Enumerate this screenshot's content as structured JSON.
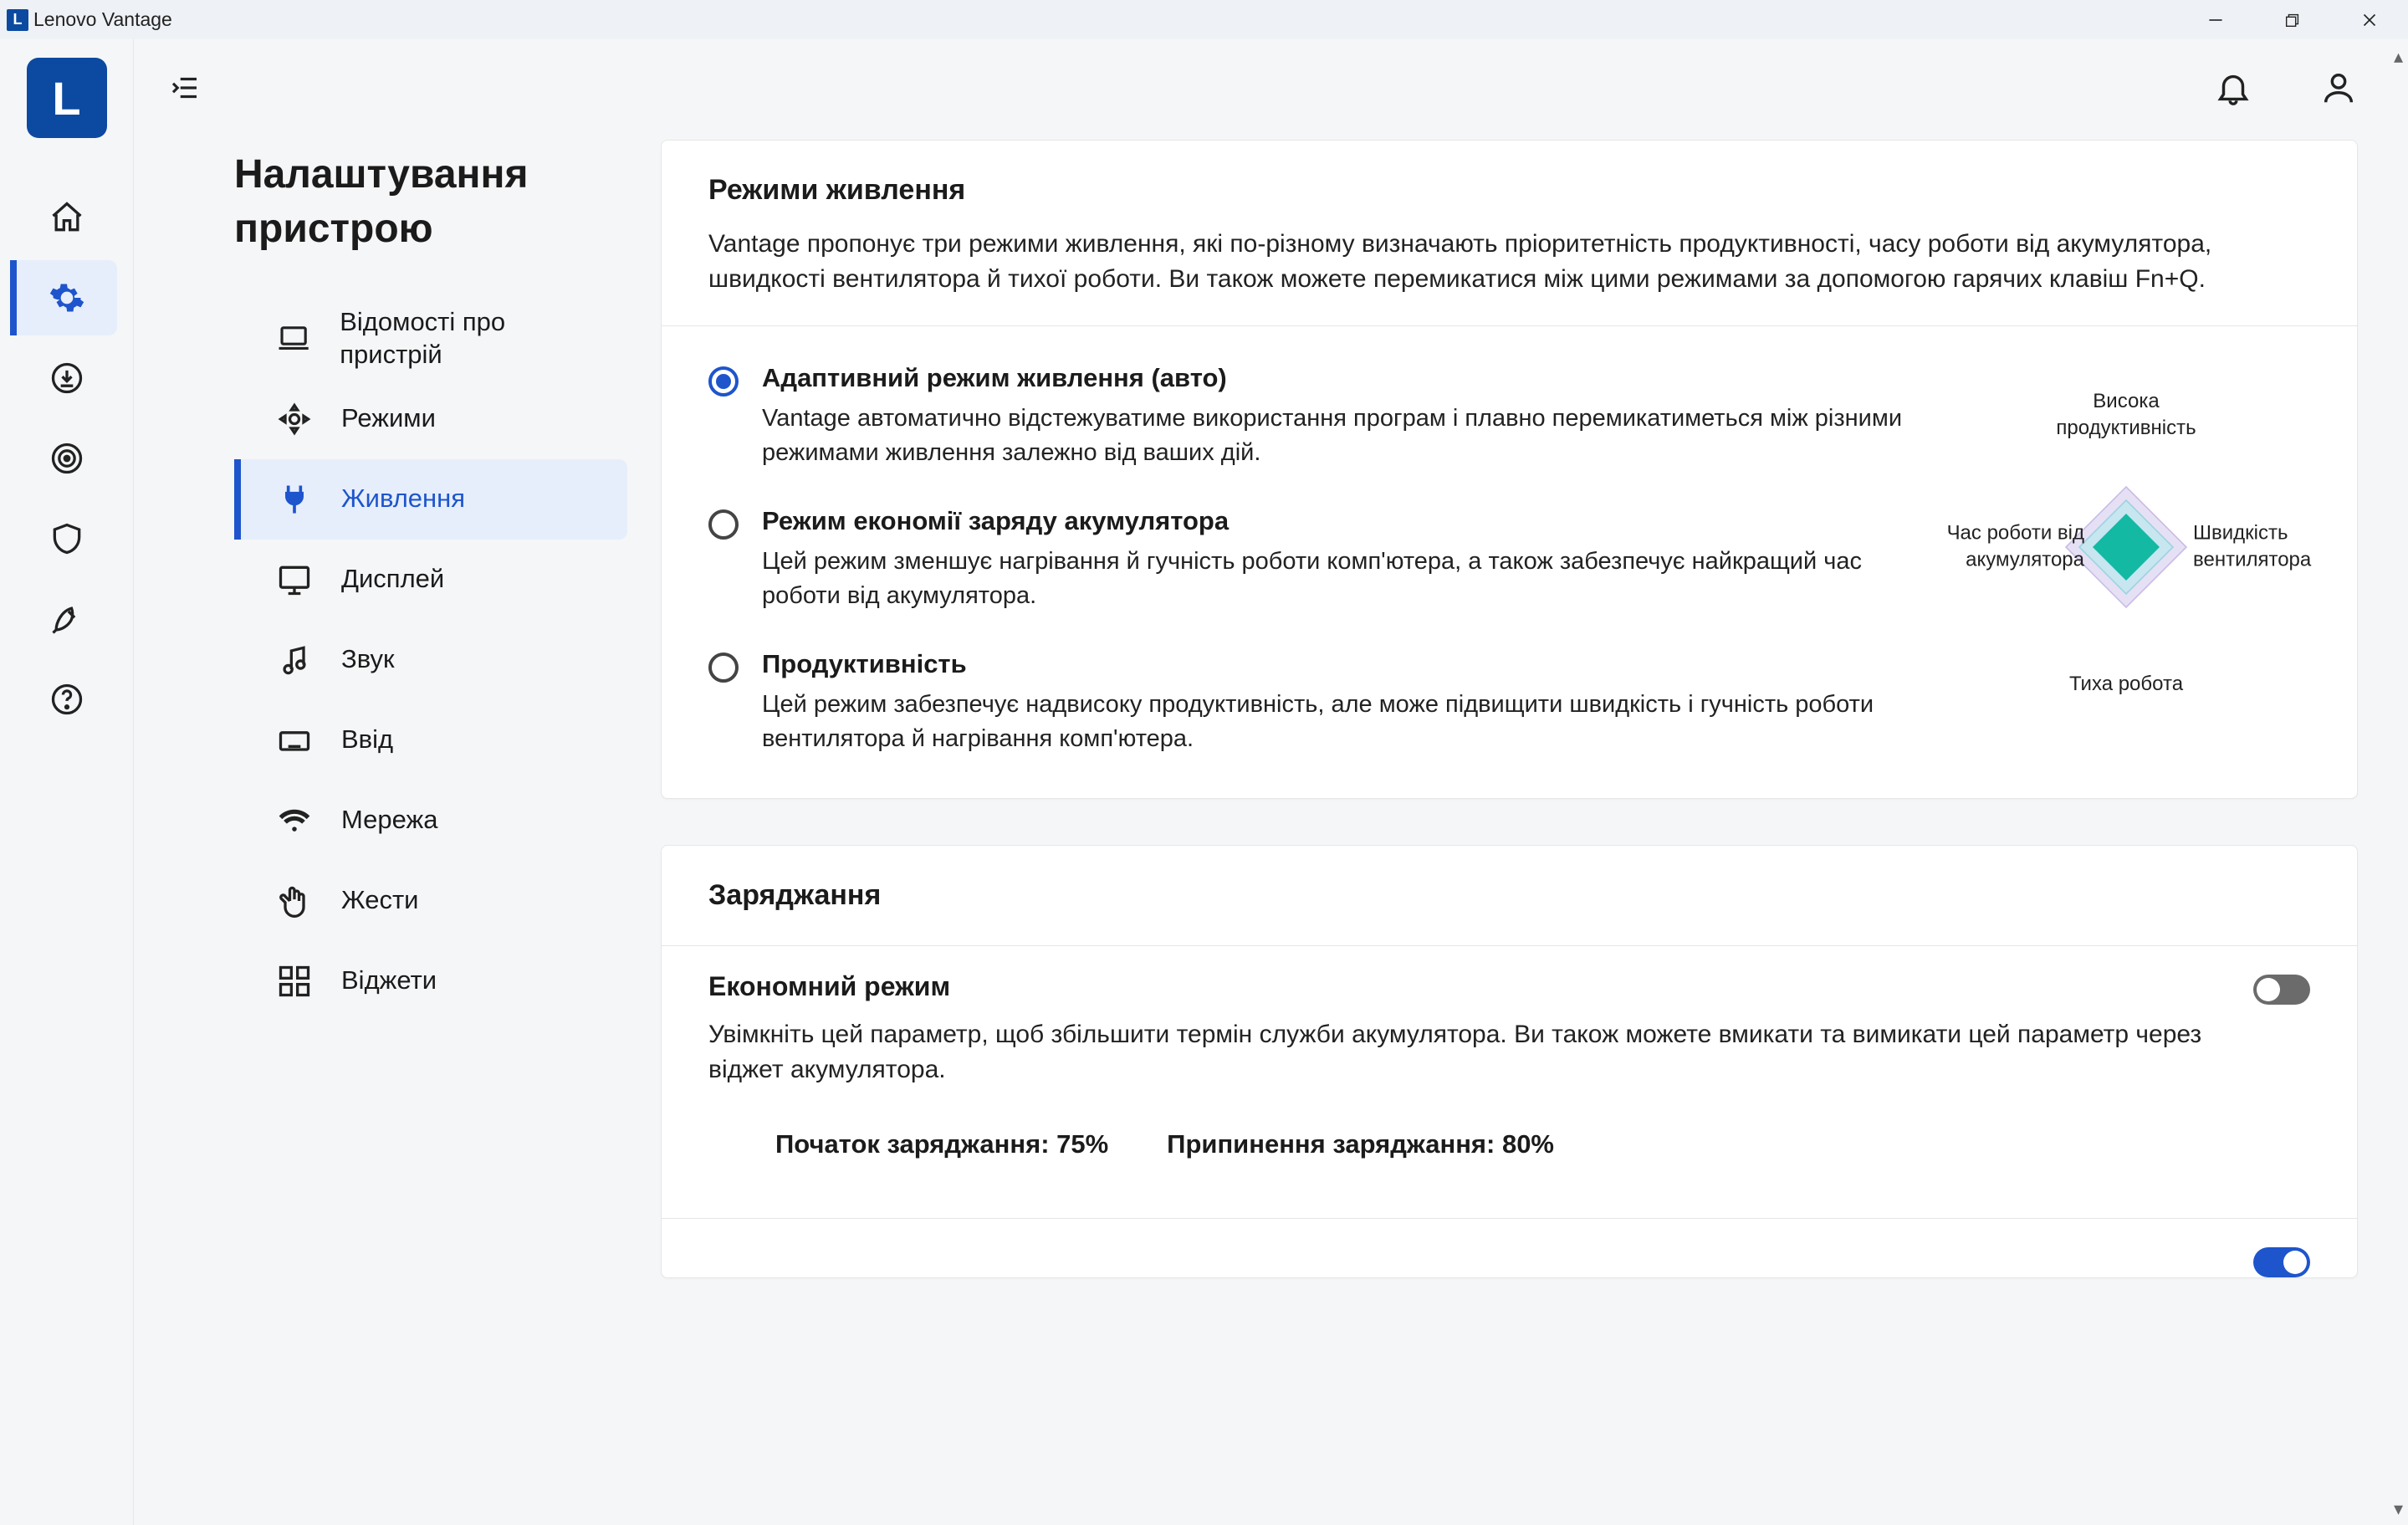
{
  "window": {
    "title": "Lenovo Vantage"
  },
  "sidebar_rail": {
    "items": [
      "home",
      "settings",
      "download",
      "target",
      "shield",
      "rocket",
      "help"
    ],
    "active": 1
  },
  "settings": {
    "title": "Налаштування пристрою",
    "items": [
      {
        "label": "Відомості про пристрій"
      },
      {
        "label": "Режими"
      },
      {
        "label": "Живлення"
      },
      {
        "label": "Дисплей"
      },
      {
        "label": "Звук"
      },
      {
        "label": "Ввід"
      },
      {
        "label": "Мережа"
      },
      {
        "label": "Жести"
      },
      {
        "label": "Віджети"
      }
    ],
    "active": 2
  },
  "power_modes": {
    "title": "Режими живлення",
    "description": "Vantage пропонує три режими живлення, які по-різному визначають пріоритетність продуктивності, часу роботи від акумулятора, швидкості вентилятора й тихої роботи. Ви також можете перемикатися між цими режимами за допомогою гарячих клавіш Fn+Q.",
    "options": [
      {
        "label": "Адаптивний режим живлення (авто)",
        "desc": "Vantage автоматично відстежуватиме використання програм і плавно перемикатиметься між різними режимами живлення залежно від ваших дій.",
        "selected": true
      },
      {
        "label": "Режим економії заряду акумулятора",
        "desc": "Цей режим зменшує нагрівання й гучність роботи комп'ютера, а також забезпечує найкращий час роботи від акумулятора.",
        "selected": false
      },
      {
        "label": "Продуктивність",
        "desc": "Цей режим забезпечує надвисоку продуктивність, але може підвищити швидкість і гучність роботи вентилятора й нагрівання комп'ютера.",
        "selected": false
      }
    ],
    "diamond": {
      "top": "Висока продуктивність",
      "left": "Час роботи від акумулятора",
      "right": "Швидкість вентилятора",
      "bottom": "Тиха робота"
    }
  },
  "charging": {
    "title": "Заряджання",
    "eco": {
      "label": "Економний режим",
      "desc": "Увімкніть цей параметр, щоб збільшити термін служби акумулятора. Ви також можете вмикати та вимикати цей параметр через віджет акумулятора.",
      "on": false
    },
    "start_label": "Початок заряджання: 75%",
    "stop_label": "Припинення заряджання: 80%",
    "rapid": {
      "on": true
    }
  }
}
